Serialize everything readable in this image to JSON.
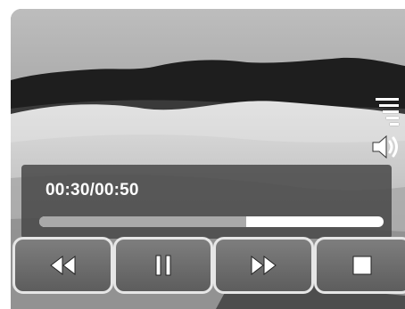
{
  "playback": {
    "time_display": "00:30/00:50",
    "progress": 0.6
  },
  "controls": {
    "buttons": [
      {
        "name": "rewind",
        "icon": "rewind-icon"
      },
      {
        "name": "pause",
        "icon": "pause-icon"
      },
      {
        "name": "fast-forward",
        "icon": "fast-forward-icon"
      },
      {
        "name": "stop",
        "icon": "stop-icon"
      }
    ]
  },
  "volume": {
    "level_icon": "volume-level-icon",
    "speaker_icon": "speaker-icon"
  },
  "colors": {
    "panel": "#484848",
    "progress_fill": "#a9a9a9",
    "progress_track": "#ffffff",
    "button_face": "#6e6e6e",
    "button_border": "#e6e6e6"
  }
}
